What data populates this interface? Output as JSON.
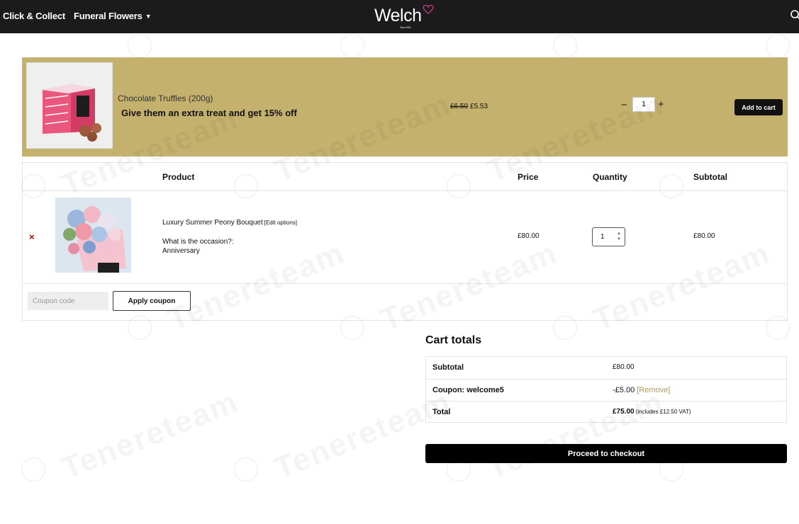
{
  "header": {
    "nav": [
      "Click & Collect",
      "Funeral Flowers"
    ],
    "logo": "Welch",
    "logo_tagline": "Since 1930"
  },
  "upsell": {
    "name": "Chocolate Truffles (200g)",
    "promo": "Give them an extra treat and get 15% off",
    "old_price": "£6.50",
    "new_price": "£5.53",
    "quantity": "1",
    "add_label": "Add to cart"
  },
  "cart": {
    "headers": {
      "product": "Product",
      "price": "Price",
      "quantity": "Quantity",
      "subtotal": "Subtotal"
    },
    "item": {
      "name": "Luxury Summer Peony Bouquet",
      "edit_label": "[Edit options]",
      "option_label": "What is the occasion?:",
      "option_value": "Anniversary",
      "price": "£80.00",
      "quantity": "1",
      "subtotal": "£80.00"
    },
    "coupon_placeholder": "Coupon code",
    "apply_label": "Apply coupon"
  },
  "totals": {
    "title": "Cart totals",
    "subtotal_label": "Subtotal",
    "subtotal_value": "£80.00",
    "coupon_label": "Coupon: welcome5",
    "coupon_value": "-£5.00",
    "remove_label": "[Remove]",
    "total_label": "Total",
    "total_value": "£75.00",
    "vat_note": "(includes £12.50 VAT)"
  },
  "checkout_label": "Proceed to checkout",
  "watermark": "Tenereteam",
  "colors": {
    "header_bg": "#1b1b1b",
    "banner_bg": "#c4b16d",
    "remove_red": "#a00000",
    "accent_gold": "#b49a5a"
  }
}
